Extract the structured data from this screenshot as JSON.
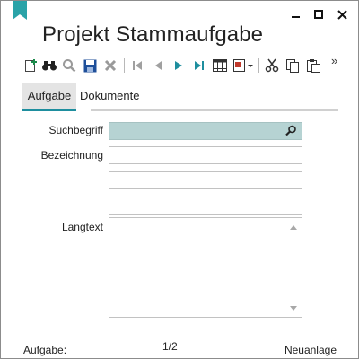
{
  "window": {
    "title": "Projekt Stammaufgabe",
    "accent_color": "#1e8e9e"
  },
  "toolbar": {
    "buttons": [
      {
        "name": "new-record-icon",
        "color": "#1a8a4a"
      },
      {
        "name": "binoculars-icon",
        "color": "#1a1a1a"
      },
      {
        "name": "magnifier-icon",
        "color": "#9a9a9a"
      },
      {
        "name": "save-icon",
        "color": "#1f4f9a"
      },
      {
        "name": "delete-icon",
        "color": "#9a9a9a"
      },
      {
        "name": "first-record-icon",
        "color": "#a0a0a0"
      },
      {
        "name": "previous-record-icon",
        "color": "#a0a0a0"
      },
      {
        "name": "next-record-icon",
        "color": "#1e8e9e"
      },
      {
        "name": "last-record-icon",
        "color": "#1e8e9e"
      },
      {
        "name": "table-view-icon",
        "color": "#333333"
      },
      {
        "name": "report-menu-icon",
        "color": "#333333"
      },
      {
        "name": "cut-icon",
        "color": "#333333"
      },
      {
        "name": "copy-icon",
        "color": "#333333"
      },
      {
        "name": "paste-icon",
        "color": "#333333"
      }
    ],
    "overflow_label": "»"
  },
  "tabs": [
    {
      "label": "Aufgabe",
      "active": true
    },
    {
      "label": "Dokumente",
      "active": false
    }
  ],
  "form": {
    "search_label": "Suchbegriff",
    "search_value": "",
    "description_label": "Bezeichnung",
    "description_value": "",
    "description_line2": "",
    "description_line3": "",
    "longtext_label": "Langtext",
    "longtext_value": ""
  },
  "status": {
    "left": "Aufgabe:",
    "center": "1/2",
    "right": "Neuanlage"
  }
}
